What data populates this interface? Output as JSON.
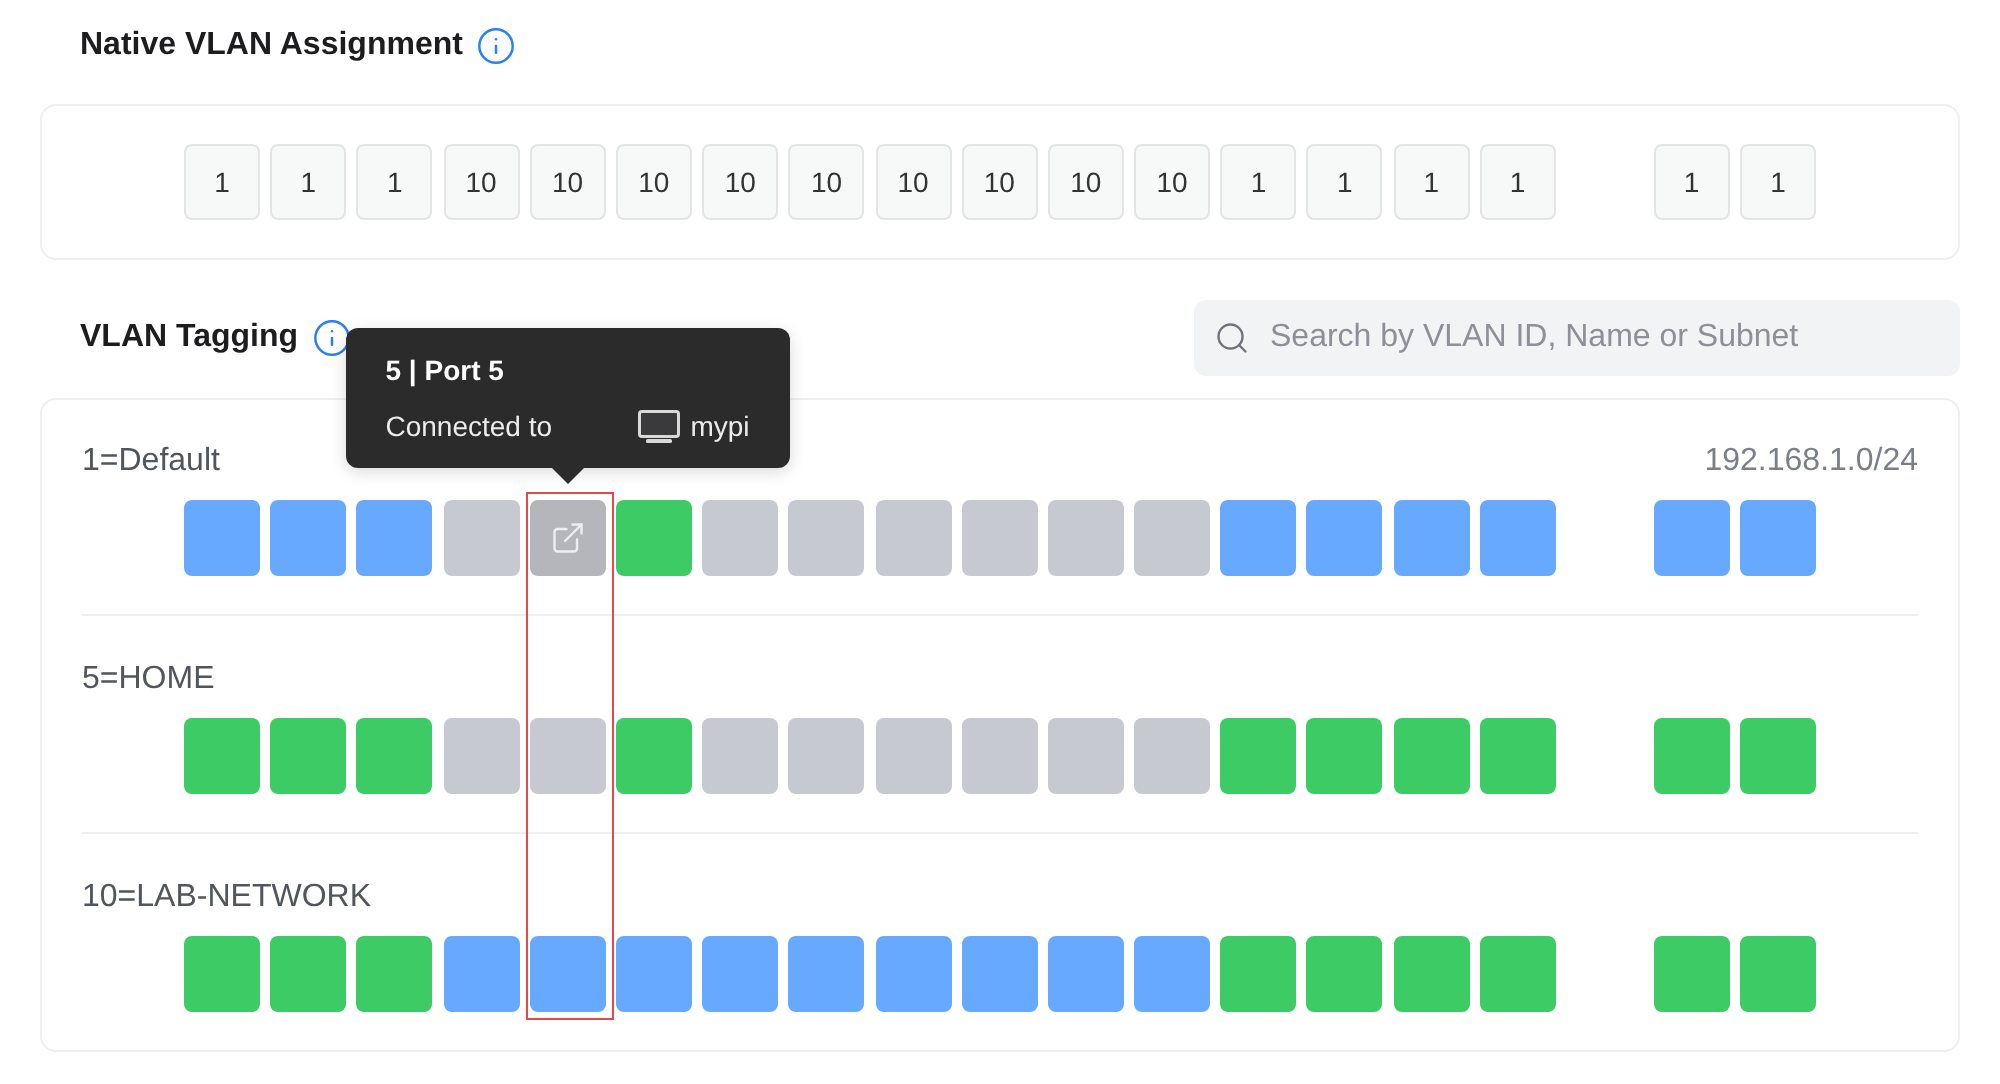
{
  "native_vlan": {
    "title": "Native VLAN Assignment",
    "port_groups": [
      {
        "ports": [
          "1",
          "1",
          "1",
          "10",
          "10",
          "10",
          "10",
          "10",
          "10",
          "10",
          "10",
          "10",
          "1",
          "1",
          "1",
          "1"
        ]
      },
      {
        "ports": [
          "1",
          "1"
        ]
      }
    ]
  },
  "tagging": {
    "title": "VLAN Tagging",
    "search": {
      "placeholder": "Search by VLAN ID, Name or Subnet"
    },
    "tooltip": {
      "title": "5 | Port 5",
      "label": "Connected to",
      "device": "mypi"
    },
    "vlans": [
      {
        "name": "1=Default",
        "subnet": "192.168.1.0/24",
        "port_groups": [
          {
            "ports": [
              {
                "color": "#66a9ff",
                "hovered": false
              },
              {
                "color": "#66a9ff",
                "hovered": false
              },
              {
                "color": "#66a9ff",
                "hovered": false
              },
              {
                "color": "#c7c9d1",
                "hovered": false
              },
              {
                "color": "#b4b6bc",
                "hovered": true
              },
              {
                "color": "#3ccb64",
                "hovered": false
              },
              {
                "color": "#c7c9d1",
                "hovered": false
              },
              {
                "color": "#c7c9d1",
                "hovered": false
              },
              {
                "color": "#c7c9d1",
                "hovered": false
              },
              {
                "color": "#c7c9d1",
                "hovered": false
              },
              {
                "color": "#c7c9d1",
                "hovered": false
              },
              {
                "color": "#c7c9d1",
                "hovered": false
              },
              {
                "color": "#66a9ff",
                "hovered": false
              },
              {
                "color": "#66a9ff",
                "hovered": false
              },
              {
                "color": "#66a9ff",
                "hovered": false
              },
              {
                "color": "#66a9ff",
                "hovered": false
              }
            ]
          },
          {
            "ports": [
              {
                "color": "#66a9ff",
                "hovered": false
              },
              {
                "color": "#66a9ff",
                "hovered": false
              }
            ]
          }
        ]
      },
      {
        "name": "5=HOME",
        "port_groups": [
          {
            "ports": [
              {
                "color": "#3ccb64",
                "hovered": false
              },
              {
                "color": "#3ccb64",
                "hovered": false
              },
              {
                "color": "#3ccb64",
                "hovered": false
              },
              {
                "color": "#c7c9d1",
                "hovered": false
              },
              {
                "color": "#c7c9d1",
                "hovered": false
              },
              {
                "color": "#3ccb64",
                "hovered": false
              },
              {
                "color": "#c7c9d1",
                "hovered": false
              },
              {
                "color": "#c7c9d1",
                "hovered": false
              },
              {
                "color": "#c7c9d1",
                "hovered": false
              },
              {
                "color": "#c7c9d1",
                "hovered": false
              },
              {
                "color": "#c7c9d1",
                "hovered": false
              },
              {
                "color": "#c7c9d1",
                "hovered": false
              },
              {
                "color": "#3ccb64",
                "hovered": false
              },
              {
                "color": "#3ccb64",
                "hovered": false
              },
              {
                "color": "#3ccb64",
                "hovered": false
              },
              {
                "color": "#3ccb64",
                "hovered": false
              }
            ]
          },
          {
            "ports": [
              {
                "color": "#3ccb64",
                "hovered": false
              },
              {
                "color": "#3ccb64",
                "hovered": false
              }
            ]
          }
        ]
      },
      {
        "name": "10=LAB-NETWORK",
        "port_groups": [
          {
            "ports": [
              {
                "color": "#3ccb64",
                "hovered": false
              },
              {
                "color": "#3ccb64",
                "hovered": false
              },
              {
                "color": "#3ccb64",
                "hovered": false
              },
              {
                "color": "#66a9ff",
                "hovered": false
              },
              {
                "color": "#66a9ff",
                "hovered": false
              },
              {
                "color": "#66a9ff",
                "hovered": false
              },
              {
                "color": "#66a9ff",
                "hovered": false
              },
              {
                "color": "#66a9ff",
                "hovered": false
              },
              {
                "color": "#66a9ff",
                "hovered": false
              },
              {
                "color": "#66a9ff",
                "hovered": false
              },
              {
                "color": "#66a9ff",
                "hovered": false
              },
              {
                "color": "#66a9ff",
                "hovered": false
              },
              {
                "color": "#3ccb64",
                "hovered": false
              },
              {
                "color": "#3ccb64",
                "hovered": false
              },
              {
                "color": "#3ccb64",
                "hovered": false
              },
              {
                "color": "#3ccb64",
                "hovered": false
              }
            ]
          },
          {
            "ports": [
              {
                "color": "#3ccb64",
                "hovered": false
              },
              {
                "color": "#3ccb64",
                "hovered": false
              }
            ]
          }
        ]
      }
    ]
  }
}
